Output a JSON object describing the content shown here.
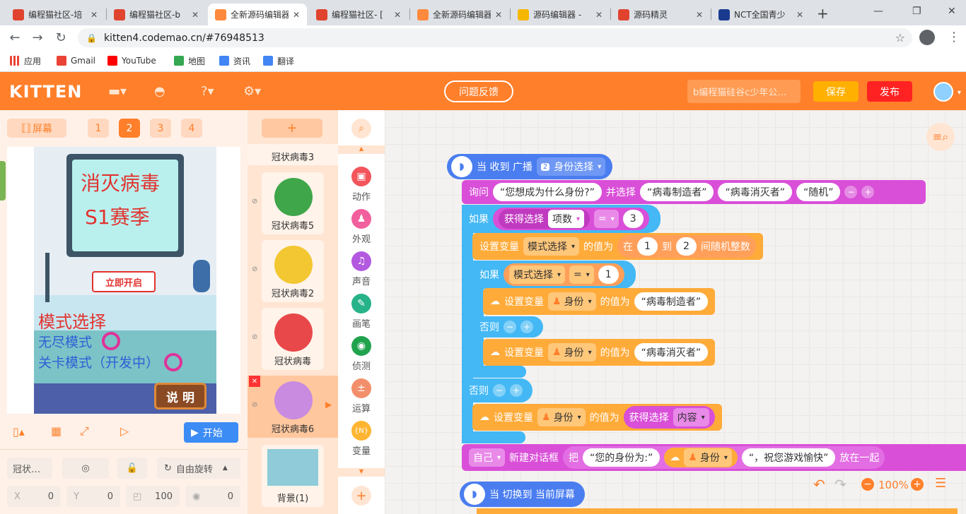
{
  "browser": {
    "tabs": [
      {
        "title": "编程猫社区-培",
        "color": "#e0442f"
      },
      {
        "title": "编程猫社区-b",
        "color": "#e0442f"
      },
      {
        "title": "全新源码编辑器",
        "color": "#ff8a3d"
      },
      {
        "title": "编程猫社区- [",
        "color": "#e0442f"
      },
      {
        "title": "全新源码编辑器",
        "color": "#ff8a3d"
      },
      {
        "title": "源码编辑器 -",
        "color": "#f6b700"
      },
      {
        "title": "源码精灵",
        "color": "#e0442f"
      },
      {
        "title": "NCT全国青少",
        "color": "#1a3a8f"
      }
    ],
    "new_tab": "+",
    "window_controls": {
      "minimize": "—",
      "restore": "❐",
      "close": "✕"
    },
    "url": "kitten4.codemao.cn/#76948513",
    "bookmarks": [
      {
        "label": "应用",
        "color": "#ea4335"
      },
      {
        "label": "Gmail",
        "color": "#ea4335"
      },
      {
        "label": "YouTube",
        "color": "#ff0000"
      },
      {
        "label": "地图",
        "color": "#34a853"
      },
      {
        "label": "资讯",
        "color": "#4285f4"
      },
      {
        "label": "翻译",
        "color": "#4285f4"
      }
    ]
  },
  "header": {
    "logo": "KITTEN",
    "feedback": "问题反馈",
    "project_name": "b编程猫硅谷c少年公…",
    "save": "保存",
    "publish": "发布"
  },
  "stage_panel": {
    "screen_label": "屏幕",
    "screens": [
      "1",
      "2",
      "3",
      "4"
    ],
    "selected_screen": "2",
    "stage_texts": {
      "title1": "消灭病毒",
      "title2": "S1赛季",
      "start_sign": "立即开启",
      "mode_title": "模式选择",
      "mode1": "无尽模式",
      "mode2": "关卡模式（开发中）",
      "help": "说 明"
    },
    "start_button": "开始",
    "props": {
      "sprite_name": "冠状…",
      "rotation": "自由旋转",
      "x_label": "X",
      "x": "0",
      "y_label": "Y",
      "y": "0",
      "size": "100",
      "direction": "0"
    }
  },
  "sprites": {
    "add": "+",
    "items": [
      {
        "label": "冠状病毒3",
        "color": ""
      },
      {
        "label": "冠状病毒5",
        "color": "#3fa64a"
      },
      {
        "label": "冠状病毒2",
        "color": "#f3c731"
      },
      {
        "label": "冠状病毒",
        "color": "#e8484a"
      },
      {
        "label": "冠状病毒6",
        "color": "#c98be0"
      },
      {
        "label": "背景(1)",
        "color": ""
      }
    ]
  },
  "categories": [
    {
      "label": "动作",
      "icon": "motion-icon",
      "color": "#f2555b"
    },
    {
      "label": "外观",
      "icon": "looks-icon",
      "color": "#f25f9d"
    },
    {
      "label": "声音",
      "icon": "sound-icon",
      "color": "#b259e0"
    },
    {
      "label": "画笔",
      "icon": "pen-icon",
      "color": "#27b389"
    },
    {
      "label": "侦测",
      "icon": "sensing-icon",
      "color": "#21a34e"
    },
    {
      "label": "运算",
      "icon": "operator-icon",
      "color": "#f28f6a"
    },
    {
      "label": "变量",
      "icon": "variable-icon",
      "color": "#ffb531"
    }
  ],
  "blocks": {
    "hat1_event": "当 收到 广播",
    "hat1_msg_num": "2",
    "hat1_msg": "身份选择",
    "ask": "询问",
    "ask_q": "“您想成为什么身份?”",
    "ask_and": "并选择",
    "opt1": "“病毒制造者”",
    "opt2": "“病毒消灭者”",
    "opt3": "“随机”",
    "if1": "如果",
    "get_choice": "获得选择",
    "index": "项数",
    "eq": "=",
    "three": "3",
    "setvar": "设置变量",
    "mode_var": "模式选择",
    "value_of": "的值为",
    "rand_in": "在",
    "one": "1",
    "to": "到",
    "two": "2",
    "rand_int": "间随机整数",
    "if2": "如果",
    "identity": "身份",
    "maker": "“病毒制造者”",
    "killer": "“病毒消灭者”",
    "else": "否则",
    "content": "内容",
    "self": "自己",
    "new_dialog": "新建对话框",
    "join": "把",
    "your_identity": "“您的身份为:”",
    "wish": "“，祝您游戏愉快”",
    "put_together": "放在一起",
    "hat2": "当 切换到 当前屏幕"
  },
  "workspace": {
    "zoom": "100%"
  }
}
